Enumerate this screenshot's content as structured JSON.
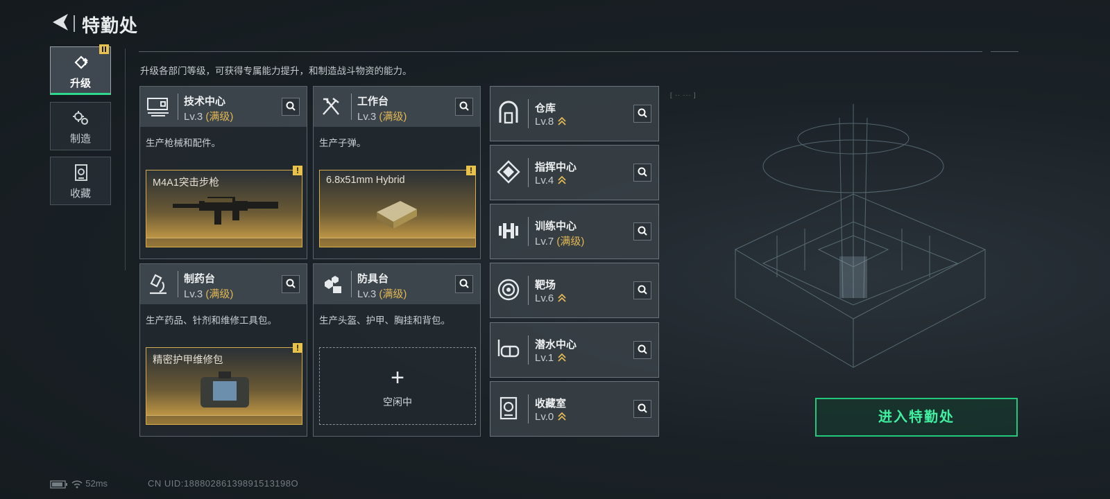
{
  "header": {
    "title": "特勤处"
  },
  "nav": [
    {
      "label": "升级",
      "icon": "upgrade-icon",
      "active": true
    },
    {
      "label": "制造",
      "icon": "gears-icon",
      "active": false
    },
    {
      "label": "收藏",
      "icon": "collection-icon",
      "active": false
    }
  ],
  "description": "升级各部门等级，可获得专属能力提升，和制造战斗物资的能力。",
  "production_cards": [
    {
      "name": "技术中心",
      "level": "Lv.3",
      "max_label": "(满级)",
      "desc": "生产枪械和配件。",
      "product": "M4A1突击步枪",
      "icon": "computer-icon"
    },
    {
      "name": "工作台",
      "level": "Lv.3",
      "max_label": "(满级)",
      "desc": "生产子弹。",
      "product": "6.8x51mm Hybrid",
      "icon": "tools-icon"
    },
    {
      "name": "制药台",
      "level": "Lv.3",
      "max_label": "(满级)",
      "desc": "生产药品、针剂和维修工具包。",
      "product": "精密护甲维修包",
      "icon": "microscope-icon"
    },
    {
      "name": "防具台",
      "level": "Lv.3",
      "max_label": "(满级)",
      "desc": "生产头盔、护甲、胸挂和背包。",
      "idle_label": "空闲中",
      "plus": "+",
      "icon": "armor-icon"
    }
  ],
  "facilities": [
    {
      "name": "仓库",
      "level": "Lv.8",
      "icon": "warehouse-icon"
    },
    {
      "name": "指挥中心",
      "level": "Lv.4",
      "icon": "command-icon"
    },
    {
      "name": "训练中心",
      "level": "Lv.7",
      "max_label": "(满级)",
      "icon": "dumbbell-icon"
    },
    {
      "name": "靶场",
      "level": "Lv.6",
      "icon": "target-icon"
    },
    {
      "name": "潜水中心",
      "level": "Lv.1",
      "icon": "diving-mask-icon"
    },
    {
      "name": "收藏室",
      "level": "Lv.0",
      "icon": "collection-room-icon"
    }
  ],
  "enter_button": "进入特勤处",
  "status": {
    "ping": "52ms",
    "uid": "CN UID:18880286139891513198O"
  },
  "colors": {
    "accent": "#2dd98a",
    "gold": "#e3b855",
    "badge": "#e8c24a"
  }
}
